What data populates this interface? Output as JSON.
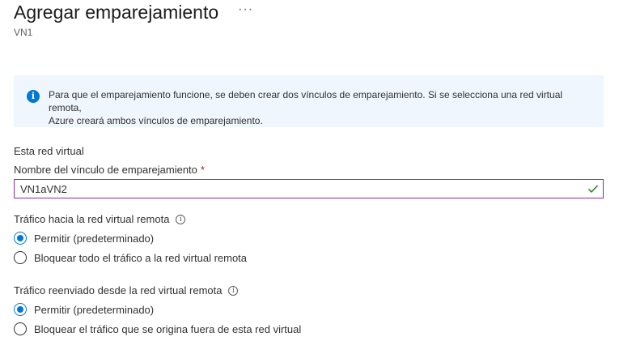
{
  "header": {
    "title": "Agregar emparejamiento",
    "more": "···",
    "subtitle": "VN1"
  },
  "info": {
    "icon": "info-icon",
    "line1": "Para que el emparejamiento funcione, se deben crear dos vínculos de emparejamiento. Si se selecciona una red virtual remota,",
    "line2": "Azure creará ambos vínculos de emparejamiento."
  },
  "this_vnet": {
    "section_label": "Esta red virtual",
    "link_name_label": "Nombre del vínculo de emparejamiento",
    "required_mark": "*",
    "link_name_value": "VN1aVN2"
  },
  "traffic_to_remote": {
    "label": "Tráfico hacia la red virtual remota",
    "options": [
      {
        "label": "Permitir (predeterminado)",
        "selected": true
      },
      {
        "label": "Bloquear todo el tráfico a la red virtual remota",
        "selected": false
      }
    ]
  },
  "forwarded_traffic": {
    "label": "Tráfico reenviado desde la red virtual remota",
    "options": [
      {
        "label": "Permitir (predeterminado)",
        "selected": true
      },
      {
        "label": "Bloquear el tráfico que se origina fuera de esta red virtual",
        "selected": false
      }
    ]
  },
  "colors": {
    "accent": "#0078d4",
    "input_border": "#8a2da5",
    "valid_check": "#107c10",
    "info_background": "#f0f6fd"
  }
}
